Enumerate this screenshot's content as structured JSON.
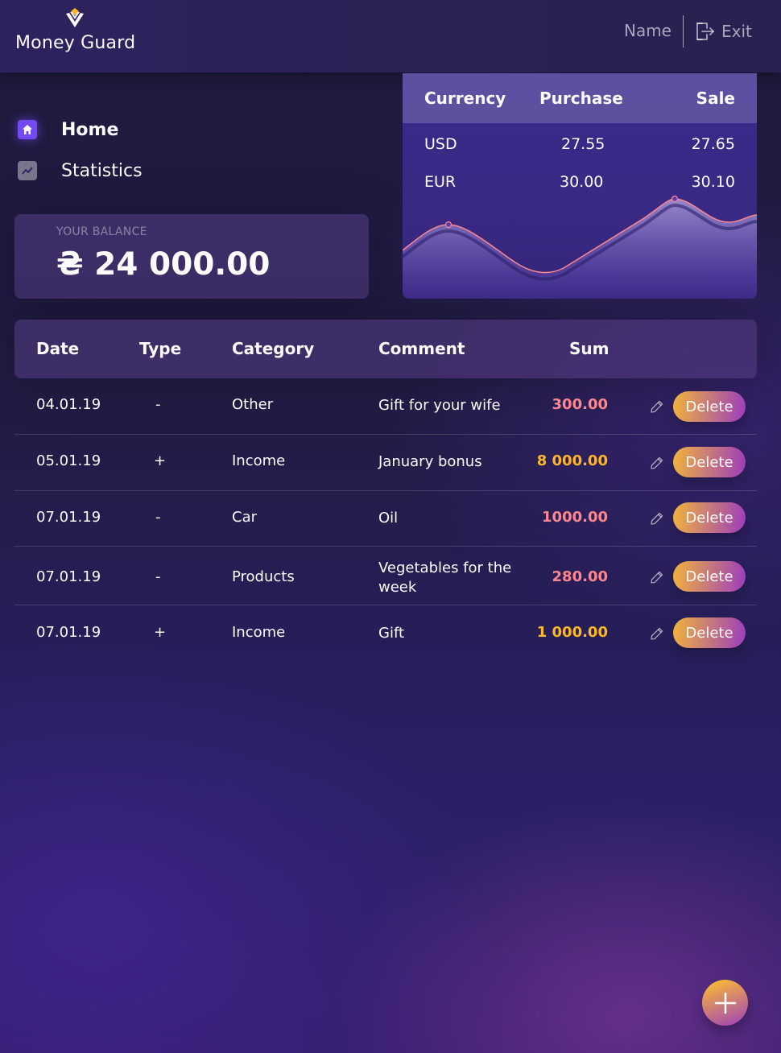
{
  "header": {
    "app_name": "Money Guard",
    "user_name": "Name",
    "exit_label": "Exit",
    "logo_icon": "money-guard-logo"
  },
  "nav": {
    "items": [
      {
        "label": "Home",
        "icon": "home-icon",
        "active": true
      },
      {
        "label": "Statistics",
        "icon": "statistics-icon",
        "active": false
      }
    ]
  },
  "balance": {
    "label": "Your balance",
    "value": "₴ 24 000.00"
  },
  "currency": {
    "headers": [
      "Currency",
      "Purchase",
      "Sale"
    ],
    "rows": [
      {
        "currency": "USD",
        "purchase": "27.55",
        "sale": "27.65"
      },
      {
        "currency": "EUR",
        "purchase": "30.00",
        "sale": "30.10"
      }
    ]
  },
  "table": {
    "headers": [
      "Date",
      "Type",
      "Category",
      "Comment",
      "Sum"
    ],
    "delete_label": "Delete",
    "rows": [
      {
        "date": "04.01.19",
        "type": "-",
        "category": "Other",
        "comment": "Gift for your wife",
        "sum": "300.00"
      },
      {
        "date": "05.01.19",
        "type": "+",
        "category": "Income",
        "comment": "January bonus",
        "sum": "8 000.00"
      },
      {
        "date": "07.01.19",
        "type": "-",
        "category": "Car",
        "comment": "Oil",
        "sum": "1000.00"
      },
      {
        "date": "07.01.19",
        "type": "-",
        "category": "Products",
        "comment": "Vegetables for the week",
        "sum": "280.00"
      },
      {
        "date": "07.01.19",
        "type": "+",
        "category": "Income",
        "comment": "Gift",
        "sum": "1 000.00"
      }
    ]
  },
  "colors": {
    "accent": "#734aef",
    "income": "#ffb627",
    "expense": "#ff868d"
  }
}
